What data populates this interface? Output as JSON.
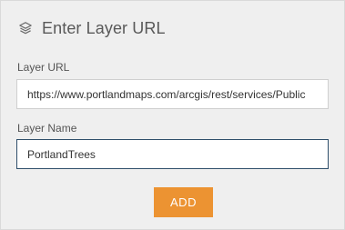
{
  "dialog": {
    "title": "Enter Layer URL",
    "title_icon": "layers-icon"
  },
  "layer_url": {
    "label": "Layer URL",
    "value": "https://www.portlandmaps.com/arcgis/rest/services/Public"
  },
  "layer_name": {
    "label": "Layer Name",
    "value": "PortlandTrees"
  },
  "actions": {
    "add_label": "ADD"
  },
  "colors": {
    "background": "#efefef",
    "accent": "#ec9332",
    "focused_border": "#2f4f6b",
    "text": "#595959"
  }
}
